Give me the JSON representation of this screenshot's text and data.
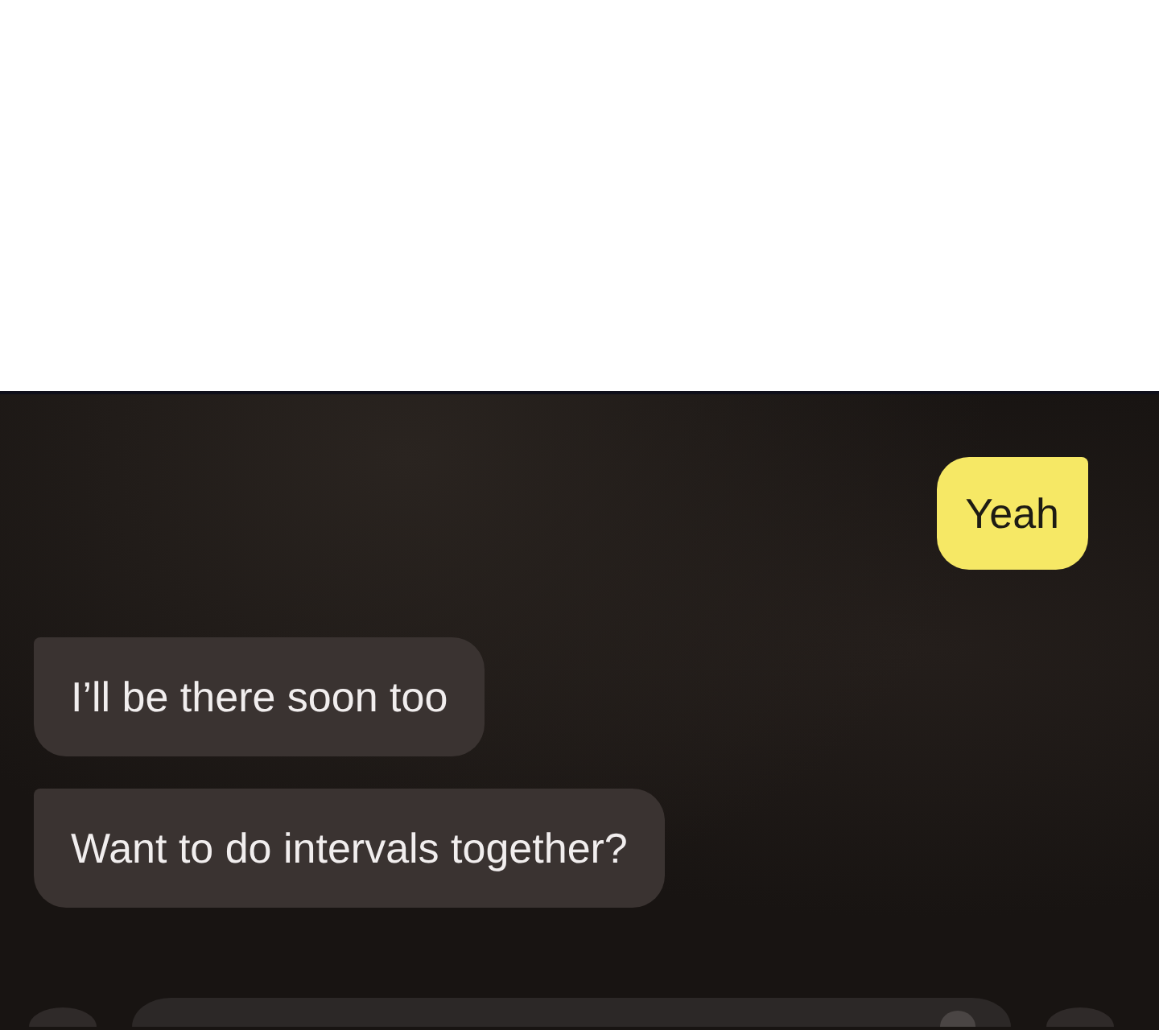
{
  "messages": [
    {
      "kind": "sent",
      "text": "Yeah"
    },
    {
      "kind": "received",
      "text": "I’ll be there soon too"
    },
    {
      "kind": "received",
      "text": "Want to do intervals together?"
    }
  ]
}
